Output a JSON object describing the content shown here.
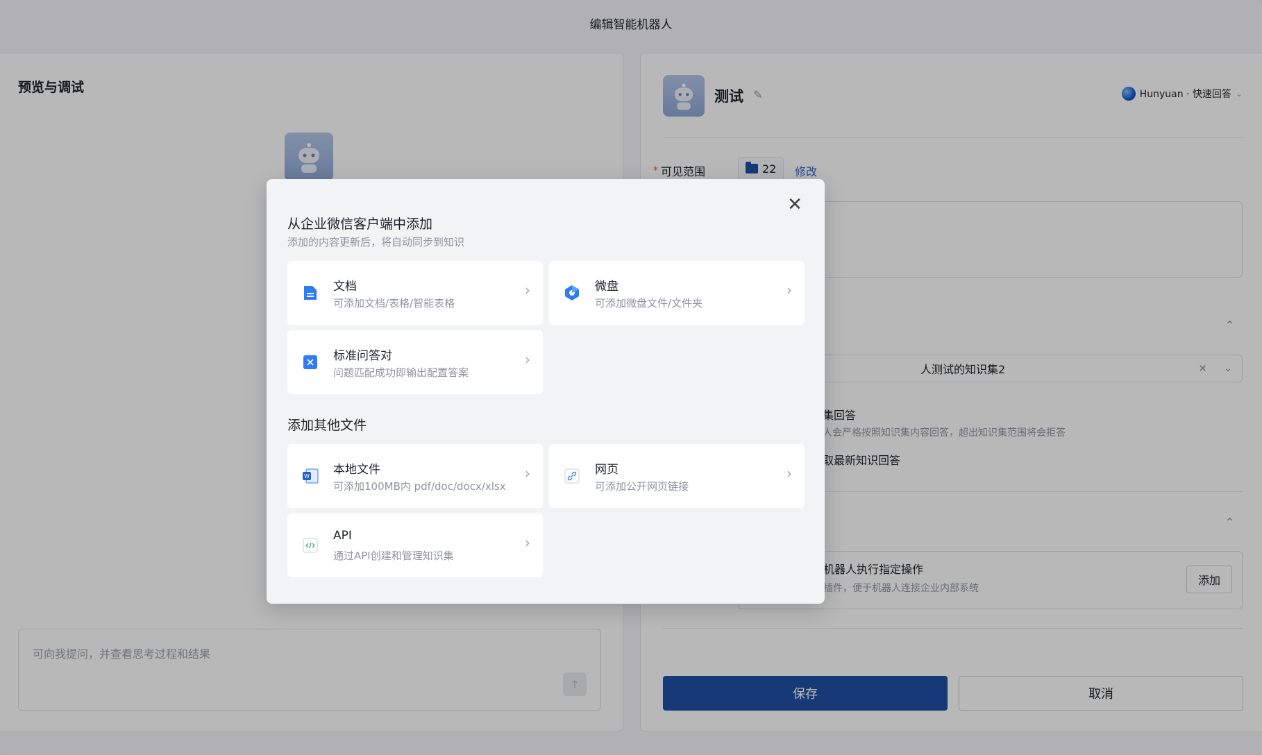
{
  "window": {
    "title": "编辑智能机器人"
  },
  "preview": {
    "title": "预览与调试",
    "input_placeholder": "可向我提问，并查看思考过程和结果",
    "send_icon": "arrow-up-icon"
  },
  "bot": {
    "name": "测试",
    "model": "Hunyuan · 快速回答",
    "visibility_label": "可见范围",
    "visibility_count": "22",
    "visibility_edit": "修改",
    "kb_selected": "人测试的知识集2",
    "kb_option_title": "集回答",
    "kb_option_desc": "人会严格按照知识集内容回答，超出知识集范围将会拒答",
    "kb_option2": "取最新知识回答",
    "plugin_title": "机器人执行指定操作",
    "plugin_desc": "插件，便于机器人连接企业内部系统",
    "plugin_add": "添加",
    "save": "保存",
    "cancel": "取消"
  },
  "modal": {
    "section1_title": "从企业微信客户端中添加",
    "section1_subtitle": "添加的内容更新后，将自动同步到知识",
    "section2_title": "添加其他文件",
    "cards": {
      "doc": {
        "title": "文档",
        "desc": "可添加文档/表格/智能表格"
      },
      "drive": {
        "title": "微盘",
        "desc": "可添加微盘文件/文件夹"
      },
      "qa": {
        "title": "标准问答对",
        "desc": "问题匹配成功即输出配置答案"
      },
      "local": {
        "title": "本地文件",
        "desc": "可添加100MB内 pdf/doc/docx/xlsx"
      },
      "web": {
        "title": "网页",
        "desc": "可添加公开网页链接"
      },
      "api": {
        "title": "API",
        "desc": "通过API创建和管理知识集"
      }
    }
  },
  "colors": {
    "primary": "#1f4fa6",
    "link": "#2f6bd4",
    "icon_blue": "#2d7cf6"
  }
}
